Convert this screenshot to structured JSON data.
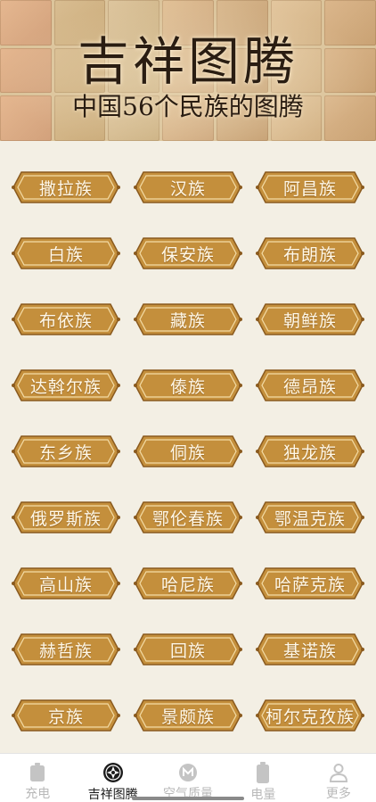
{
  "header": {
    "title": "吉祥图腾",
    "subtitle": "中国56个民族的图腾"
  },
  "tribes": [
    {
      "label": "撒拉族"
    },
    {
      "label": "汉族"
    },
    {
      "label": "阿昌族"
    },
    {
      "label": "白族"
    },
    {
      "label": "保安族"
    },
    {
      "label": "布朗族"
    },
    {
      "label": "布依族"
    },
    {
      "label": "藏族"
    },
    {
      "label": "朝鲜族"
    },
    {
      "label": "达斡尔族"
    },
    {
      "label": "傣族"
    },
    {
      "label": "德昂族"
    },
    {
      "label": "东乡族"
    },
    {
      "label": "侗族"
    },
    {
      "label": "独龙族"
    },
    {
      "label": "俄罗斯族"
    },
    {
      "label": "鄂伦春族"
    },
    {
      "label": "鄂温克族"
    },
    {
      "label": "高山族"
    },
    {
      "label": "哈尼族"
    },
    {
      "label": "哈萨克族"
    },
    {
      "label": "赫哲族"
    },
    {
      "label": "回族"
    },
    {
      "label": "基诺族"
    },
    {
      "label": "京族"
    },
    {
      "label": "景颇族"
    },
    {
      "label": "柯尔克孜族"
    }
  ],
  "nav": [
    {
      "label": "充电",
      "icon": "battery-charge-icon",
      "active": false
    },
    {
      "label": "吉祥图腾",
      "icon": "totem-icon",
      "active": true
    },
    {
      "label": "空气质量",
      "icon": "air-quality-icon",
      "active": false
    },
    {
      "label": "电量",
      "icon": "battery-level-icon",
      "active": false
    },
    {
      "label": "更多",
      "icon": "user-more-icon",
      "active": false
    }
  ],
  "colors": {
    "tag_fill": "#c48f3c",
    "tag_border": "#8a5a1e",
    "background": "#f3efe4",
    "nav_active": "#1c1c1c",
    "nav_inactive": "#b9b9b9"
  }
}
